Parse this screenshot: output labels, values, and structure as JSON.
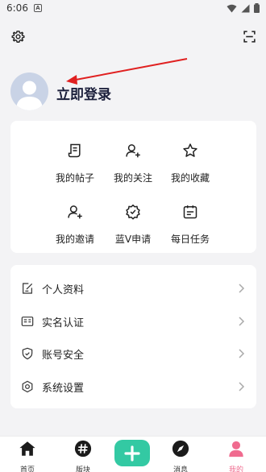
{
  "status_bar": {
    "time": "6:06",
    "notification_letter": "A"
  },
  "profile": {
    "login_label": "立即登录"
  },
  "grid": [
    {
      "label": "我的帖子",
      "icon": "post-icon"
    },
    {
      "label": "我的关注",
      "icon": "follow-icon"
    },
    {
      "label": "我的收藏",
      "icon": "star-icon"
    },
    {
      "label": "我的邀请",
      "icon": "invite-icon"
    },
    {
      "label": "蓝V申请",
      "icon": "badge-icon"
    },
    {
      "label": "每日任务",
      "icon": "calendar-icon"
    }
  ],
  "menu": [
    {
      "label": "个人资料",
      "icon": "profile-icon"
    },
    {
      "label": "实名认证",
      "icon": "id-card-icon"
    },
    {
      "label": "账号安全",
      "icon": "shield-icon"
    },
    {
      "label": "系统设置",
      "icon": "settings-icon"
    }
  ],
  "tabs": [
    {
      "label": "首页",
      "icon": "home-icon"
    },
    {
      "label": "版块",
      "icon": "hashtag-icon"
    },
    {
      "label": "",
      "icon": "plus-icon"
    },
    {
      "label": "消息",
      "icon": "compass-icon"
    },
    {
      "label": "我的",
      "icon": "user-icon",
      "active": true
    }
  ],
  "colors": {
    "accent": "#33c9a3",
    "active_tab": "#f06b8f",
    "arrow": "#e02020",
    "background": "#f3f3f5"
  }
}
